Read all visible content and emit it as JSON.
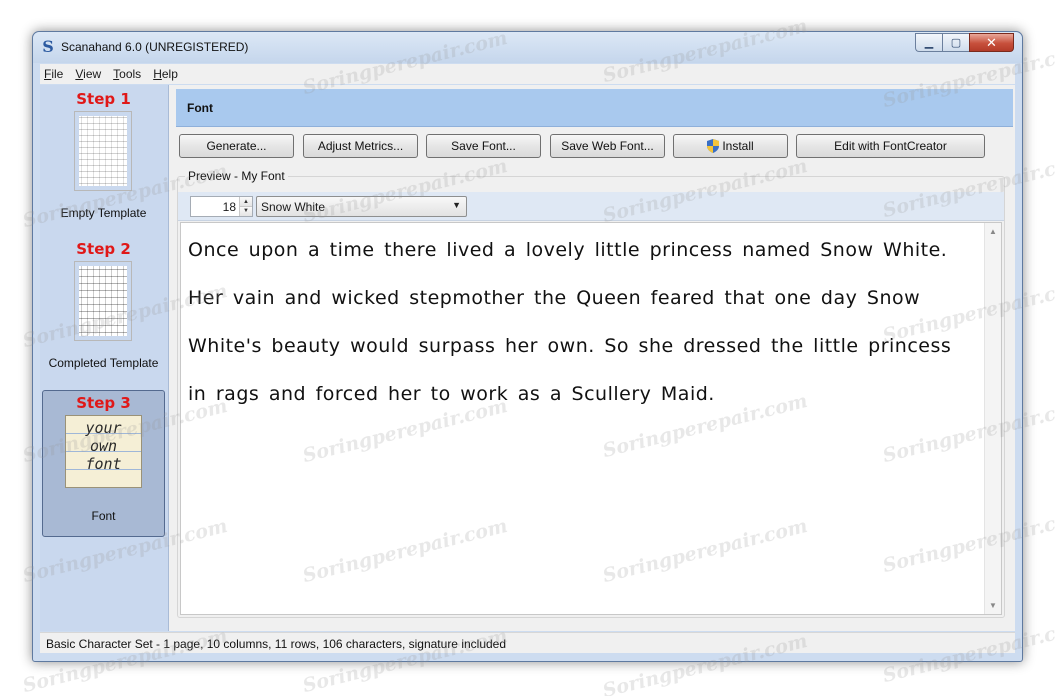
{
  "window": {
    "title": "Scanahand 6.0 (UNREGISTERED)",
    "icon": "scanahand-s-icon"
  },
  "watermark": "Soringperepair.com",
  "menu": [
    {
      "label": "File",
      "accel": "F",
      "rest": "ile"
    },
    {
      "label": "View",
      "accel": "V",
      "rest": "iew"
    },
    {
      "label": "Tools",
      "accel": "T",
      "rest": "ools"
    },
    {
      "label": "Help",
      "accel": "H",
      "rest": "elp"
    }
  ],
  "sidebar": {
    "steps": [
      {
        "title": "Step 1",
        "label": "Empty Template"
      },
      {
        "title": "Step 2",
        "label": "Completed Template"
      },
      {
        "title": "Step 3",
        "label": "Font",
        "thumb_lines": [
          "your",
          "own",
          "font"
        ]
      }
    ]
  },
  "header": {
    "title": "Font"
  },
  "toolbar": {
    "generate": "Generate...",
    "adjust_metrics": "Adjust Metrics...",
    "save_font": "Save Font...",
    "save_web_font": "Save Web Font...",
    "install": "Install",
    "edit_with_fontcreator": "Edit with FontCreator"
  },
  "preview": {
    "group_label": "Preview - My Font",
    "size": "18",
    "sample_selected": "Snow White",
    "text": "Once upon a time there lived a lovely little princess named Snow White. Her vain and wicked stepmother the Queen feared that one day Snow White's beauty would surpass her own. So she dressed the little princess in rags and forced her to work as a Scullery Maid."
  },
  "status": {
    "text": "Basic Character Set - 1 page, 10 columns, 11 rows, 106 characters, signature included"
  },
  "colors": {
    "step_title": "#e01818",
    "header_bg": "#a9c9ee",
    "sidebar_bg": "#c9d8ee"
  }
}
